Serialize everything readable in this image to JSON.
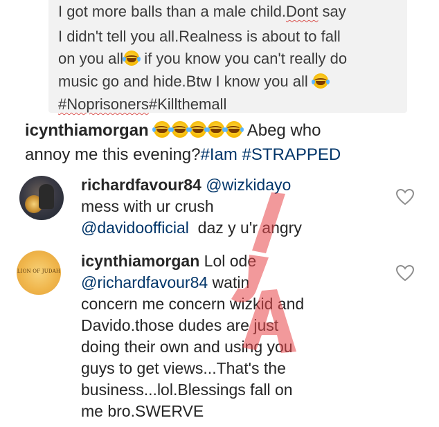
{
  "caption": {
    "lines": [
      {
        "before": "I got more balls than a male child.",
        "squiggle": "Dont",
        "after": " say"
      },
      {
        "text": "I didn't tell you all.Realness is about to fall"
      },
      {
        "before": "on you all",
        "after": " if you know you can't really do"
      },
      {
        "text": "music go and hide.Btw I know you all "
      },
      {
        "squiggle": "#Noprisoners",
        "after": "#Killthemall"
      }
    ]
  },
  "post": {
    "username": "icynthiamorgan",
    "emoji_count": 5,
    "text_after_emoji": " Abeg who",
    "line2_text": "annoy me this evening?",
    "hashtag1": "#Iam",
    "hashtag2": "#STRAPPED"
  },
  "comments": [
    {
      "username": "richardfavour84",
      "mention": "@wizkidayo",
      "line2": "mess with ur crush",
      "mention2": "@davidoofficial",
      "line3_after": "  daz y u'r angry",
      "avatar_icon": "profile-photo-icon"
    },
    {
      "username": "icynthiamorgan",
      "text_after_username": " Lol ode",
      "mention": "@richardfavour84",
      "mention_after": " watin",
      "lines": [
        "concern me concern wizkid and",
        "Davido.those dudes are just",
        "doing their own and using you",
        "guys to get views...That's the",
        "business...lol.Blessings fall on",
        "me bro.SWERVE"
      ],
      "avatar_text": "LION OF JUDAH",
      "avatar_icon": "lion-of-judah-avatar-icon"
    }
  ],
  "icons": {
    "like": "heart-outline-icon",
    "emoji": "face-with-tears-of-joy-icon"
  },
  "colors": {
    "text": "#262626",
    "link": "#003569",
    "caption_bg": "#f2f2f2",
    "heart_stroke": "#8e8e8e",
    "watermark": "#e8464a"
  }
}
